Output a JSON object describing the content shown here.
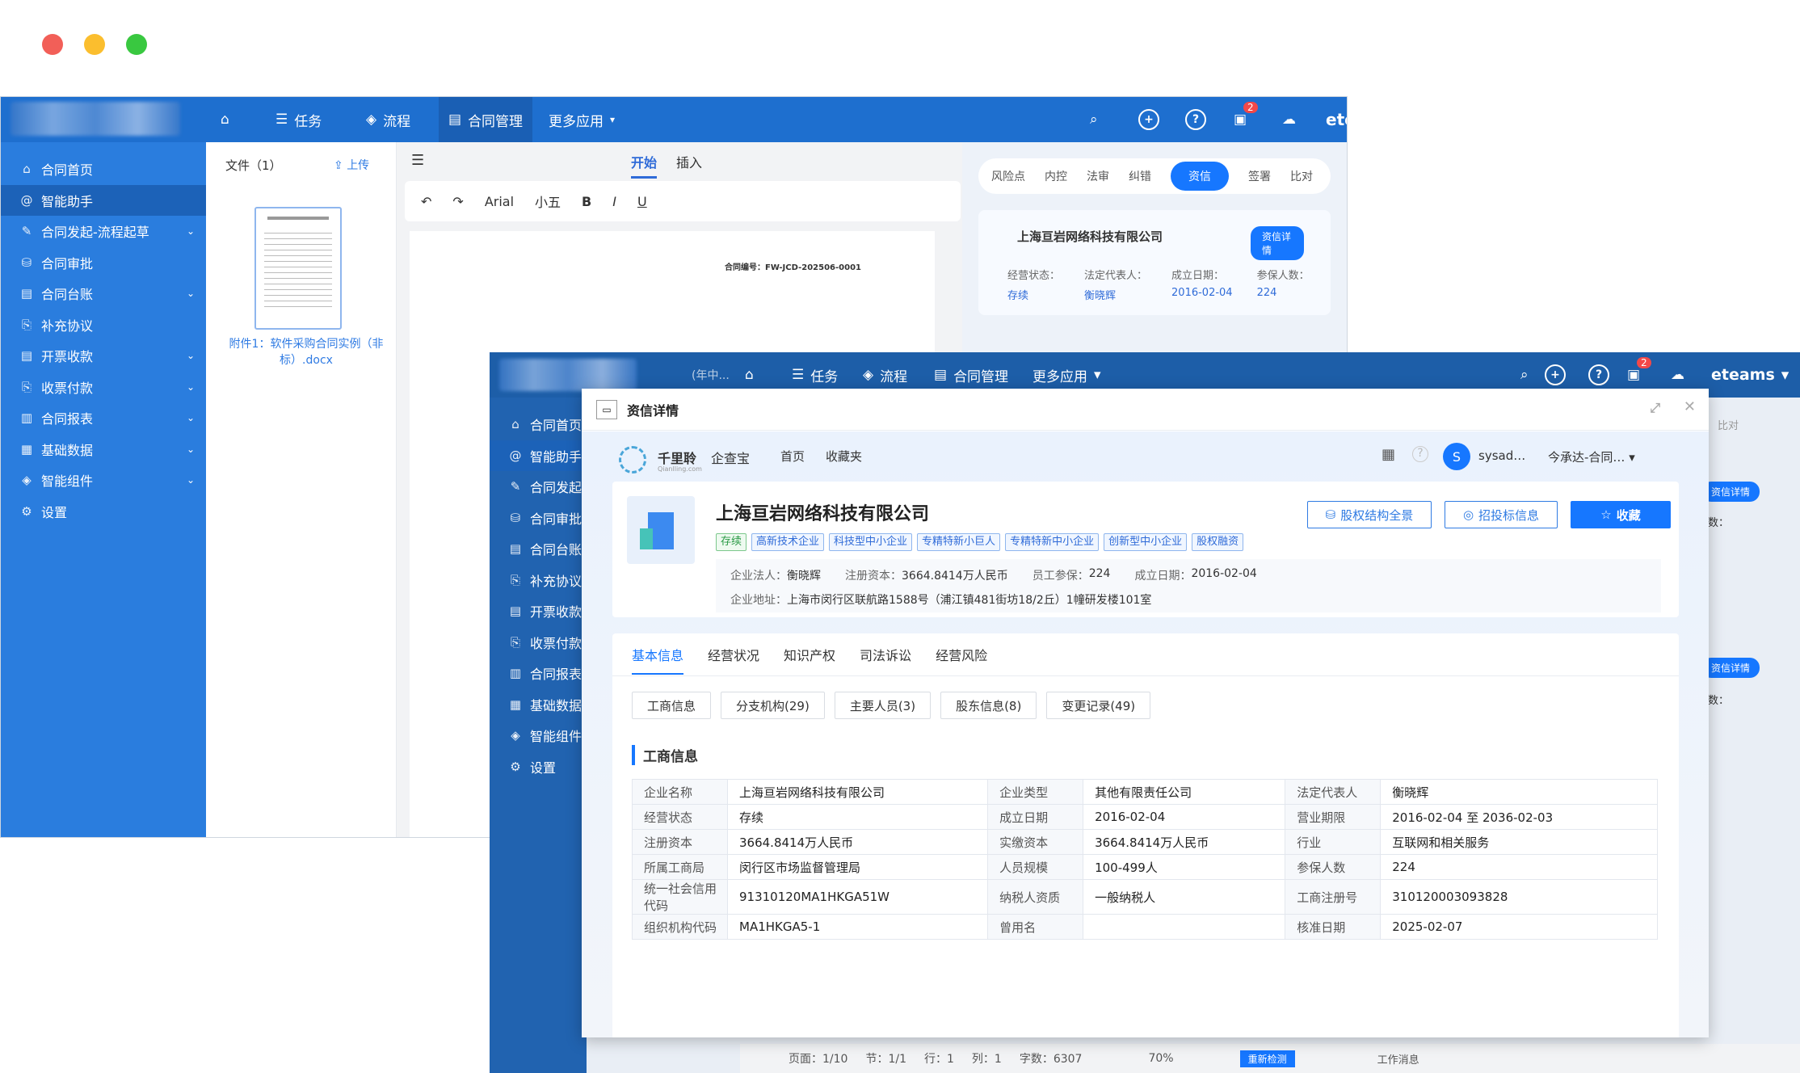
{
  "traffic_lights": {
    "red": "#f25f58",
    "yellow": "#fbbe2e",
    "green": "#39c840"
  },
  "back_window": {
    "nav": {
      "home_icon": "home-icon",
      "tasks": "任务",
      "flow": "流程",
      "contract": "合同管理",
      "more": "更多应用",
      "brand": "eteams",
      "badge": "2"
    },
    "sidebar": [
      "合同首页",
      "智能助手",
      "合同发起-流程起草",
      "合同审批",
      "合同台账",
      "补充协议",
      "开票收款",
      "收票付款",
      "合同报表",
      "基础数据",
      "智能组件",
      "设置"
    ],
    "files": {
      "header": "文件（1）",
      "upload": "上传",
      "name": "附件1：软件采购合同实例（非标）.docx",
      "thumb_title": "合同编号"
    },
    "editor": {
      "tab_start": "开始",
      "tab_insert": "插入",
      "font": "Arial",
      "size": "小五",
      "contract_no": "合同编号：FW-JCD-202506-0001",
      "page_label": "页面"
    },
    "risk": {
      "tabs": [
        "风险点",
        "内控",
        "法审",
        "纠错",
        "资信",
        "签署",
        "比对"
      ],
      "company": "上海亘岩网络科技有限公司",
      "detail_btn": "资信详情",
      "fields": [
        {
          "k": "经营状态：",
          "v": "存续"
        },
        {
          "k": "法定代表人：",
          "v": "衡晓辉"
        },
        {
          "k": "成立日期：",
          "v": "2016-02-04"
        },
        {
          "k": "参保人数：",
          "v": "224"
        }
      ]
    }
  },
  "front_window": {
    "nav": {
      "tasks": "任务",
      "flow": "流程",
      "contract": "合同管理",
      "more": "更多应用",
      "brand": "eteams",
      "badge": "2",
      "tab_partial": "(年中..."
    },
    "sidebar": [
      "合同首页",
      "智能助手",
      "合同发起-",
      "合同审批",
      "合同台账",
      "补充协议",
      "开票收款",
      "收票付款",
      "合同报表",
      "基础数据",
      "智能组件",
      "设置"
    ],
    "right_peek": {
      "bidui": "比对",
      "detail1": "资信详情",
      "detail2": "资信详情",
      "shu1": "数：",
      "shu2": "数："
    },
    "statusbar": {
      "page": "页面：1/10",
      "section": "节：1/1",
      "row": "行：1",
      "col": "列：1",
      "words": "字数：6307",
      "zoom": "70%",
      "recheck": "重新检测",
      "work_msg": "工作消息"
    }
  },
  "modal": {
    "title": "资信详情",
    "qcc": {
      "brand": "千里聆",
      "brand_en": "Qianlling.com",
      "qcc": "企查宝",
      "home": "首页",
      "fav": "收藏夹",
      "user": "sysad…",
      "user_initial": "S",
      "org": "今承达-合同…"
    },
    "company": {
      "name": "上海亘岩网络科技有限公司",
      "tags": [
        "存续",
        "高新技术企业",
        "科技型中小企业",
        "专精特新小巨人",
        "专精特新中小企业",
        "创新型中小企业",
        "股权融资"
      ],
      "btn_equity": "股权结构全景",
      "btn_bid": "招投标信息",
      "btn_fav": "收藏",
      "legal_k": "企业法人：",
      "legal_v": "衡晓辉",
      "capital_k": "注册资本：",
      "capital_v": "3664.8414万人民币",
      "staff_k": "员工参保：",
      "staff_v": "224",
      "date_k": "成立日期：",
      "date_v": "2016-02-04",
      "addr_k": "企业地址：",
      "addr_v": "上海市闵行区联航路1588号（浦江镇481街坊18/2丘）1幢研发楼101室"
    },
    "tabs": [
      "基本信息",
      "经营状况",
      "知识产权",
      "司法诉讼",
      "经营风险"
    ],
    "subtabs": [
      "工商信息",
      "分支机构(29)",
      "主要人员(3)",
      "股东信息(8)",
      "变更记录(49)"
    ],
    "section": "工商信息",
    "table": [
      [
        "企业名称",
        "上海亘岩网络科技有限公司",
        "企业类型",
        "其他有限责任公司",
        "法定代表人",
        "衡晓辉"
      ],
      [
        "经营状态",
        "存续",
        "成立日期",
        "2016-02-04",
        "营业期限",
        "2016-02-04 至 2036-02-03"
      ],
      [
        "注册资本",
        "3664.8414万人民币",
        "实缴资本",
        "3664.8414万人民币",
        "行业",
        "互联网和相关服务"
      ],
      [
        "所属工商局",
        "闵行区市场监督管理局",
        "人员规模",
        "100-499人",
        "参保人数",
        "224"
      ],
      [
        "统一社会信用代码",
        "91310120MA1HKGA51W",
        "纳税人资质",
        "一般纳税人",
        "工商注册号",
        "310120003093828"
      ],
      [
        "组织机构代码",
        "MA1HKGA5-1",
        "曾用名",
        "",
        "核准日期",
        "2025-02-07"
      ]
    ]
  }
}
